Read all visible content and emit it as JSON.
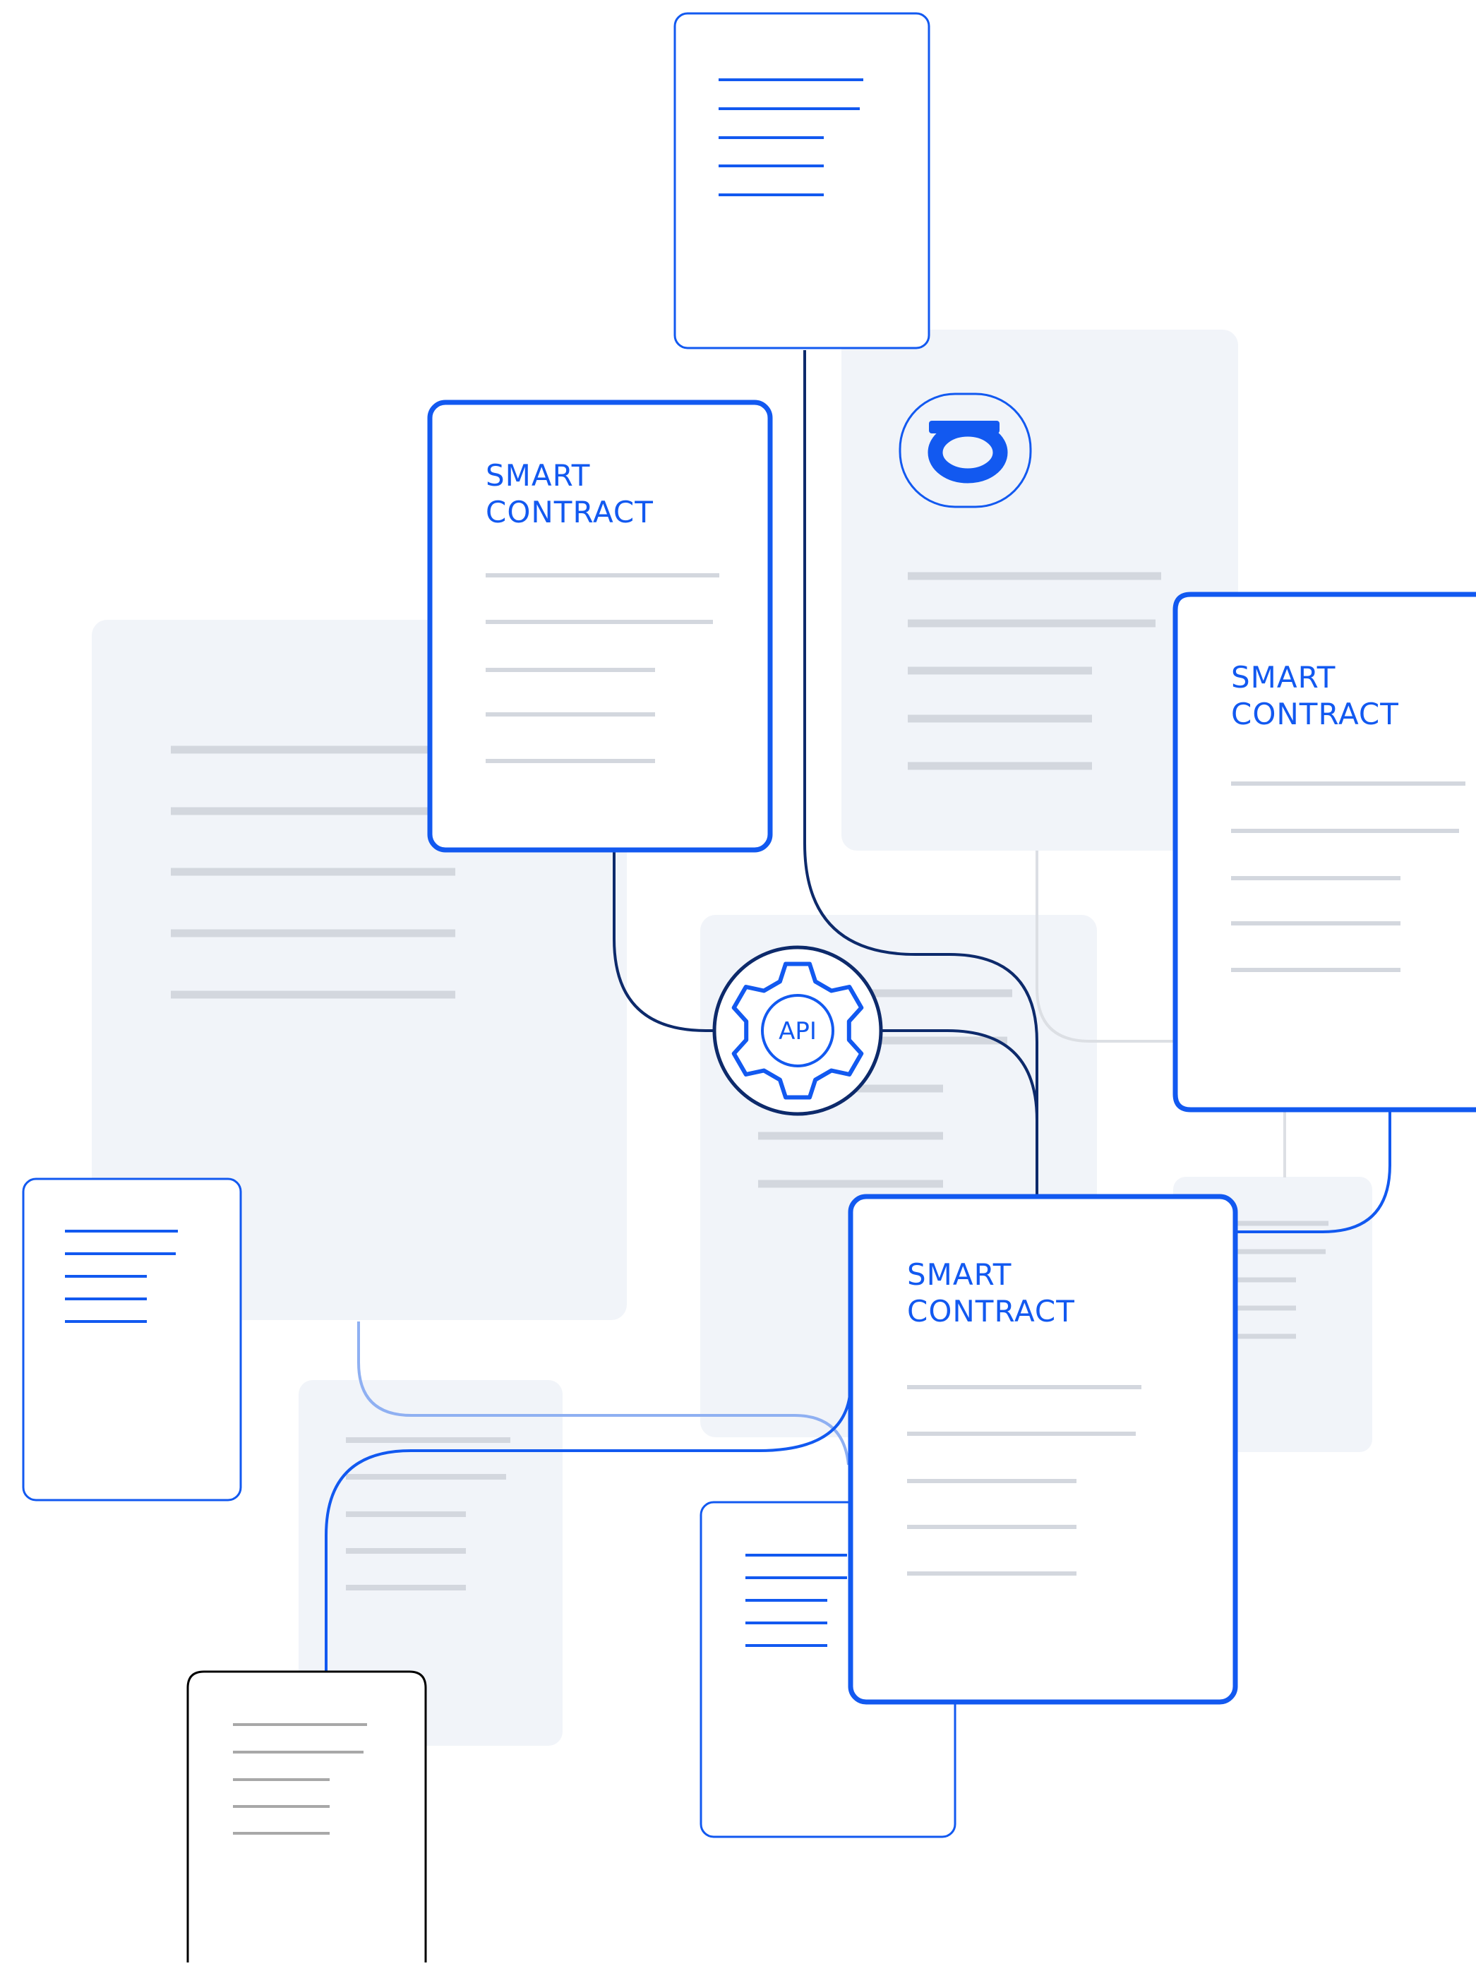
{
  "colors": {
    "accent_blue": "#1259f0",
    "navy_line": "#0d2a6b",
    "pale_card": "#f1f4f9",
    "gray_line": "#d3d7de",
    "black_outline": "#000000",
    "dark_gray_line": "#a8a8a8"
  },
  "cards": [
    {
      "id": "smart-contract-left",
      "title_line1": "SMART",
      "title_line2": "CONTRACT"
    },
    {
      "id": "smart-contract-right",
      "title_line1": "SMART",
      "title_line2": "CONTRACT"
    },
    {
      "id": "smart-contract-center",
      "title_line1": "SMART",
      "title_line2": "CONTRACT"
    }
  ],
  "api_node": {
    "label": "API",
    "icon": "gear-icon"
  },
  "logo": {
    "name": "sigma-logo-icon"
  }
}
